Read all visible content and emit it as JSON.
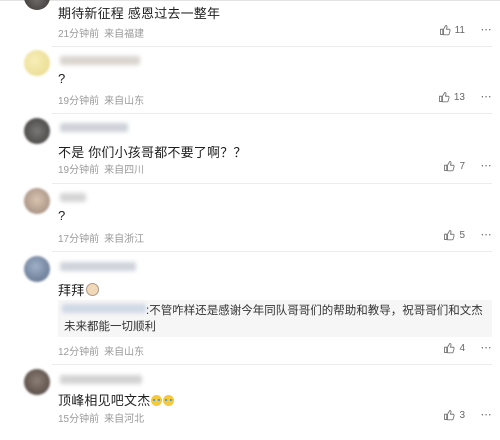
{
  "comments": [
    {
      "text": "期待新征程 感恩过去一整年",
      "time": "21分钟前",
      "location": "来自福建",
      "likes": "11"
    },
    {
      "text": "?",
      "time": "19分钟前",
      "location": "来自山东",
      "likes": "13"
    },
    {
      "text": "不是 你们小孩哥都不要了啊？？",
      "time": "19分钟前",
      "location": "来自四川",
      "likes": "7"
    },
    {
      "text": "?",
      "time": "17分钟前",
      "location": "来自浙江",
      "likes": "5"
    },
    {
      "text": "拜拜",
      "time": "12分钟前",
      "location": "来自山东",
      "likes": "4",
      "reply": {
        "line1": ":不管咋样还是感谢今年同队哥哥们的帮助和教导，祝哥哥们和文杰",
        "line2": "未来都能一切顺利"
      }
    },
    {
      "text": "顶峰相见吧文杰",
      "time": "15分钟前",
      "location": "来自河北",
      "likes": "3"
    }
  ],
  "icons": {
    "like": "thumbs-up-icon",
    "more": "more-options-icon"
  },
  "colors": {
    "text": "#1f1f1f",
    "meta": "#9a9a9a",
    "reply_bg": "#f6f6f6"
  }
}
